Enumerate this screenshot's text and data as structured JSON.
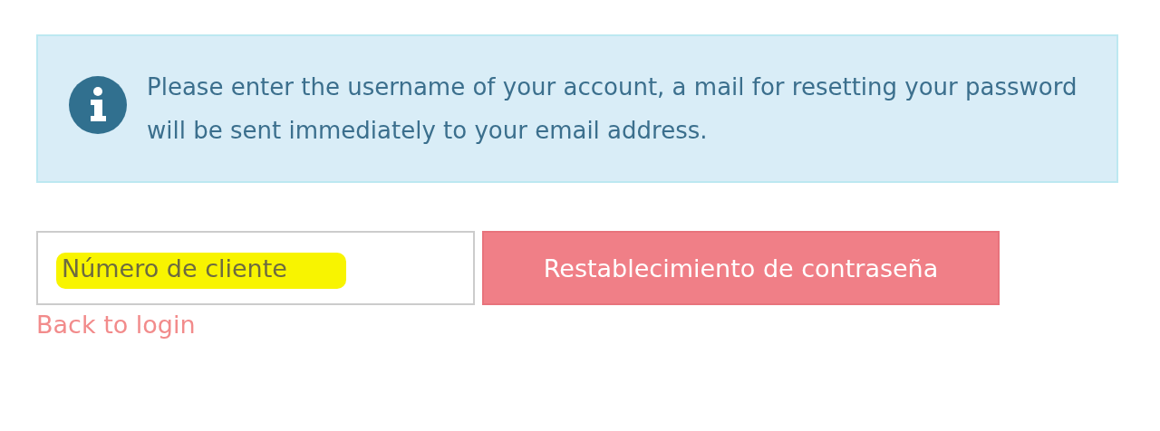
{
  "alert": {
    "kind": "info",
    "message": "Please enter the username of your account, a mail for resetting your password will be sent immediately to your email address."
  },
  "form": {
    "username": {
      "placeholder": "Número de cliente",
      "highlighted": true
    },
    "submit_button": "Restablecimiento de contraseña",
    "back_link": "Back to login"
  }
}
